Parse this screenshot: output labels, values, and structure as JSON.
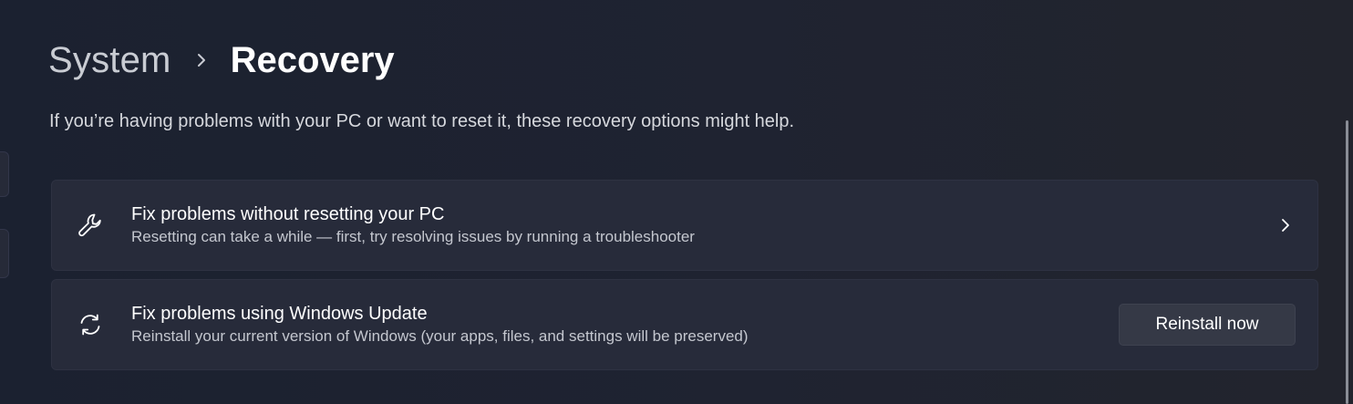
{
  "breadcrumb": {
    "parent": "System",
    "current": "Recovery"
  },
  "subtitle": "If you’re having problems with your PC or want to reset it, these recovery options might help.",
  "cards": [
    {
      "icon": "wrench-icon",
      "title": "Fix problems without resetting your PC",
      "description": "Resetting can take a while — first, try resolving issues by running a troubleshooter"
    },
    {
      "icon": "sync-icon",
      "title": "Fix problems using Windows Update",
      "description": "Reinstall your current version of Windows (your apps, files, and settings will be preserved)",
      "button_label": "Reinstall now"
    }
  ],
  "colors": {
    "background": "#1c2130",
    "card": "#272b3a",
    "button": "#353946"
  }
}
